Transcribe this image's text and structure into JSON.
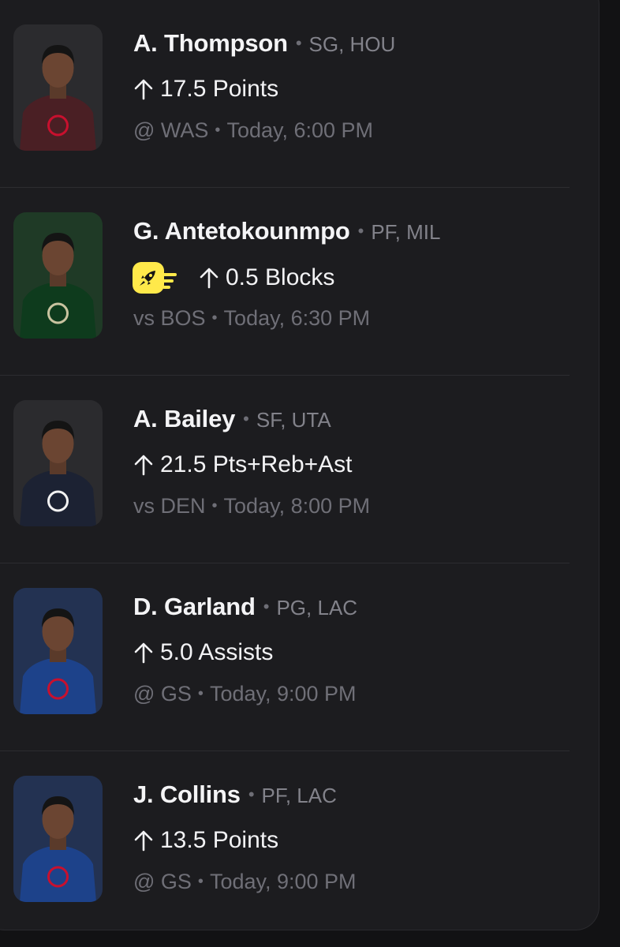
{
  "players": [
    {
      "name": "A. Thompson",
      "position": "SG, HOU",
      "prop": "17.5 Points",
      "has_boost": false,
      "matchup": "@ WAS",
      "time": "Today, 6:00 PM",
      "team_colors": {
        "bg": "#2b2b2e",
        "jersey": "#4a1f24",
        "logo": "#c8102e"
      }
    },
    {
      "name": "G. Antetokounmpo",
      "position": "PF, MIL",
      "prop": "0.5 Blocks",
      "has_boost": true,
      "boost_icon": "rocket-icon",
      "matchup": "vs BOS",
      "time": "Today, 6:30 PM",
      "team_colors": {
        "bg": "#1f3a26",
        "jersey": "#0e3b1d",
        "logo": "#c9c3a0"
      }
    },
    {
      "name": "A. Bailey",
      "position": "SF, UTA",
      "prop": "21.5 Pts+Reb+Ast",
      "has_boost": false,
      "matchup": "vs DEN",
      "time": "Today, 8:00 PM",
      "team_colors": {
        "bg": "#2b2b2e",
        "jersey": "#1c2233",
        "logo": "#f2f2f2"
      }
    },
    {
      "name": "D. Garland",
      "position": "PG, LAC",
      "prop": "5.0 Assists",
      "has_boost": false,
      "matchup": "@ GS",
      "time": "Today, 9:00 PM",
      "team_colors": {
        "bg": "#233252",
        "jersey": "#1d428a",
        "logo": "#c8102e"
      }
    },
    {
      "name": "J. Collins",
      "position": "PF, LAC",
      "prop": "13.5 Points",
      "has_boost": false,
      "matchup": "@ GS",
      "time": "Today, 9:00 PM",
      "team_colors": {
        "bg": "#233252",
        "jersey": "#1d428a",
        "logo": "#c8102e"
      }
    }
  ],
  "icons": {
    "over_arrow": "arrow-up-icon",
    "separator": "•"
  },
  "colors": {
    "background": "#121214",
    "card": "#1c1c1f",
    "name": "#f4f4f6",
    "muted": "#82828a",
    "boost_yellow": "#ffe94a"
  }
}
